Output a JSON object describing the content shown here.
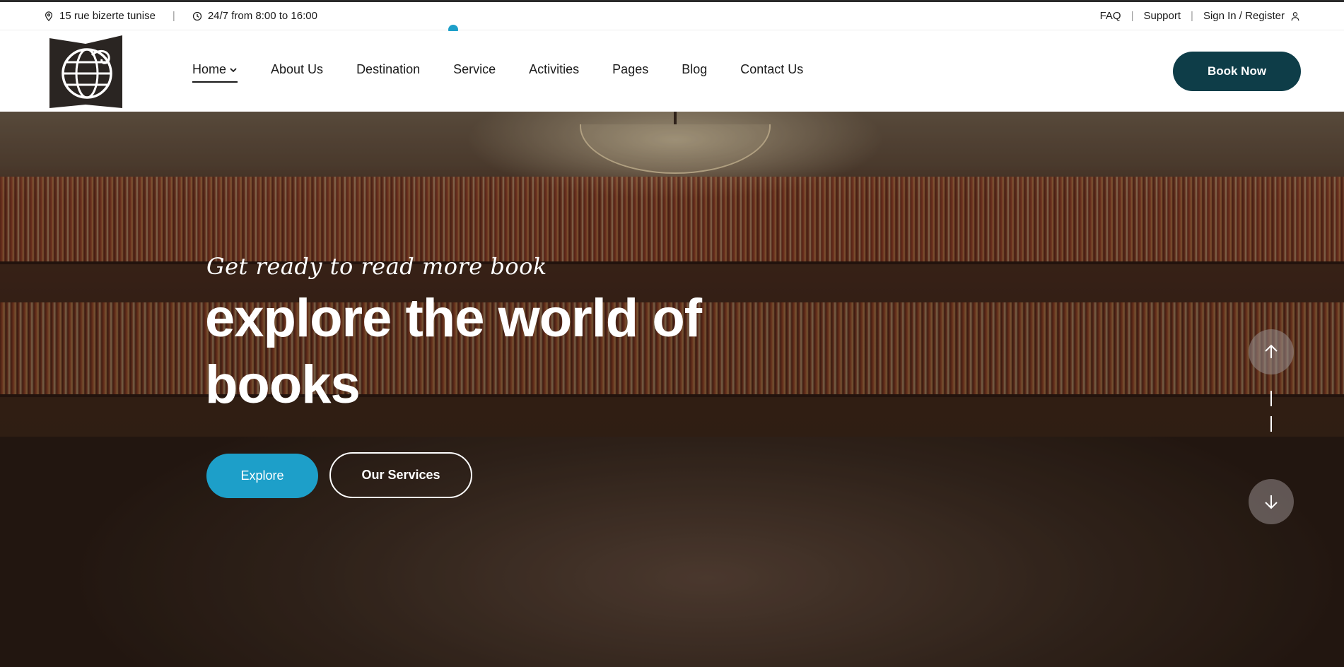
{
  "topbar": {
    "address": "15 rue bizerte tunise",
    "hours": "24/7 from 8:00 to 16:00",
    "links": {
      "faq": "FAQ",
      "support": "Support",
      "signin": "Sign In / Register"
    },
    "separator": "|"
  },
  "nav": {
    "items": [
      {
        "label": "Home",
        "active": true,
        "has_dropdown": true
      },
      {
        "label": "About Us"
      },
      {
        "label": "Destination"
      },
      {
        "label": "Service"
      },
      {
        "label": "Activities"
      },
      {
        "label": "Pages"
      },
      {
        "label": "Blog"
      },
      {
        "label": "Contact Us"
      }
    ],
    "cta_label": "Book Now"
  },
  "hero": {
    "subtitle": "Get ready to read more book",
    "title": "explore the world of books",
    "primary_button": "Explore",
    "secondary_button": "Our Services"
  },
  "icons": {
    "address": "map-pin-icon",
    "hours": "clock-icon",
    "signin": "user-icon",
    "logo": "globe-logo-icon",
    "slide_up": "arrow-up-icon",
    "slide_down": "arrow-down-icon"
  },
  "colors": {
    "accent": "#1d9fc9",
    "cta": "#0e3d48",
    "text": "#1a1a1a"
  }
}
